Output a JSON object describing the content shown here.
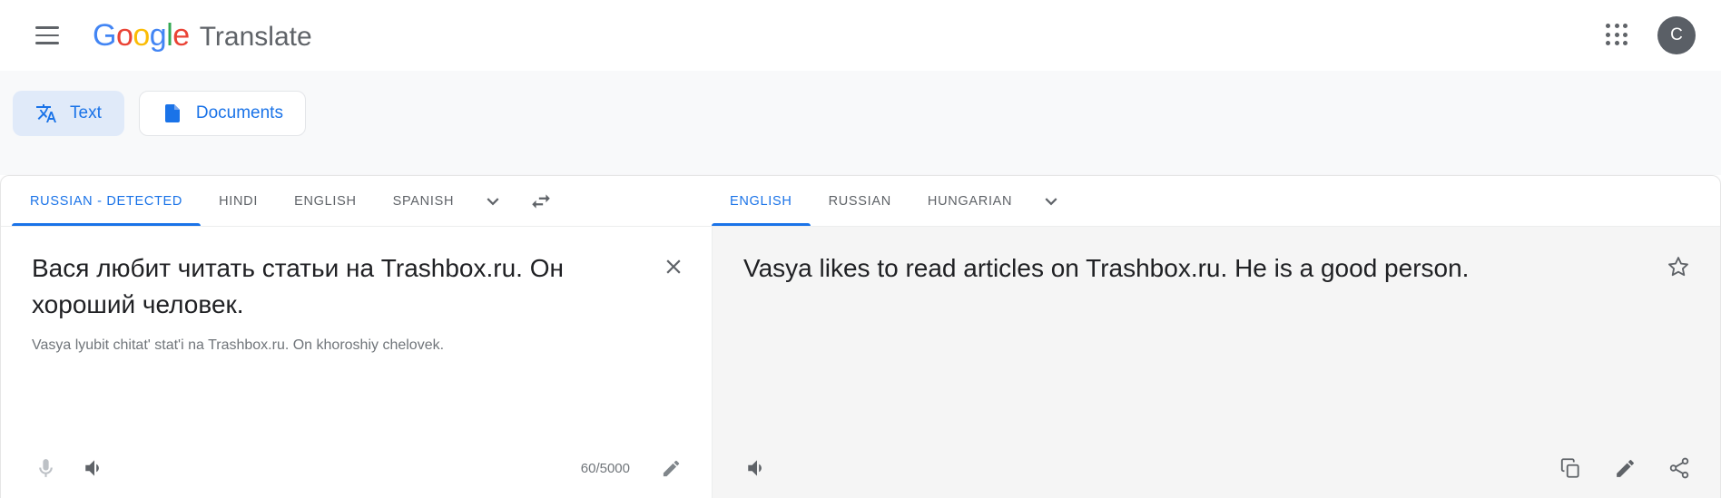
{
  "header": {
    "menu_icon": "hamburger-menu-icon",
    "logo": {
      "letters": [
        "G",
        "o",
        "o",
        "g",
        "l",
        "e"
      ]
    },
    "product_name": "Translate",
    "apps_icon": "google-apps-grid-icon",
    "avatar_initial": "C"
  },
  "mode_tabs": [
    {
      "label": "Text",
      "icon": "translate-text-icon",
      "active": true
    },
    {
      "label": "Documents",
      "icon": "document-icon",
      "active": false
    }
  ],
  "source": {
    "languages": [
      "RUSSIAN - DETECTED",
      "HINDI",
      "ENGLISH",
      "SPANISH"
    ],
    "active_language": "RUSSIAN - DETECTED",
    "more_icon": "chevron-down-icon",
    "text": "Вася любит читать статьи на Trashbox.ru. Он хороший человек.",
    "transliteration": "Vasya lyubit chitat' stat'i na Trashbox.ru. On khoroshiy chelovek.",
    "clear_icon": "close-icon",
    "mic_icon": "microphone-icon",
    "speaker_icon": "speaker-icon",
    "char_counter": "60/5000",
    "edit_icon": "pencil-icon"
  },
  "swap": {
    "icon": "swap-languages-icon"
  },
  "target": {
    "languages": [
      "ENGLISH",
      "RUSSIAN",
      "HUNGARIAN"
    ],
    "active_language": "ENGLISH",
    "more_icon": "chevron-down-icon",
    "text": "Vasya likes to read articles on Trashbox.ru. He is a good person.",
    "star_icon": "star-outline-icon",
    "speaker_icon": "speaker-icon",
    "copy_icon": "copy-icon",
    "edit_icon": "pencil-icon",
    "share_icon": "share-icon"
  },
  "colors": {
    "accent": "#1a73e8",
    "active_tab_bg": "#e0eaf9",
    "page_bg": "#f8f9fa",
    "result_pane_bg": "#f5f5f5",
    "text_primary": "#202124",
    "text_secondary": "#5f6368"
  }
}
